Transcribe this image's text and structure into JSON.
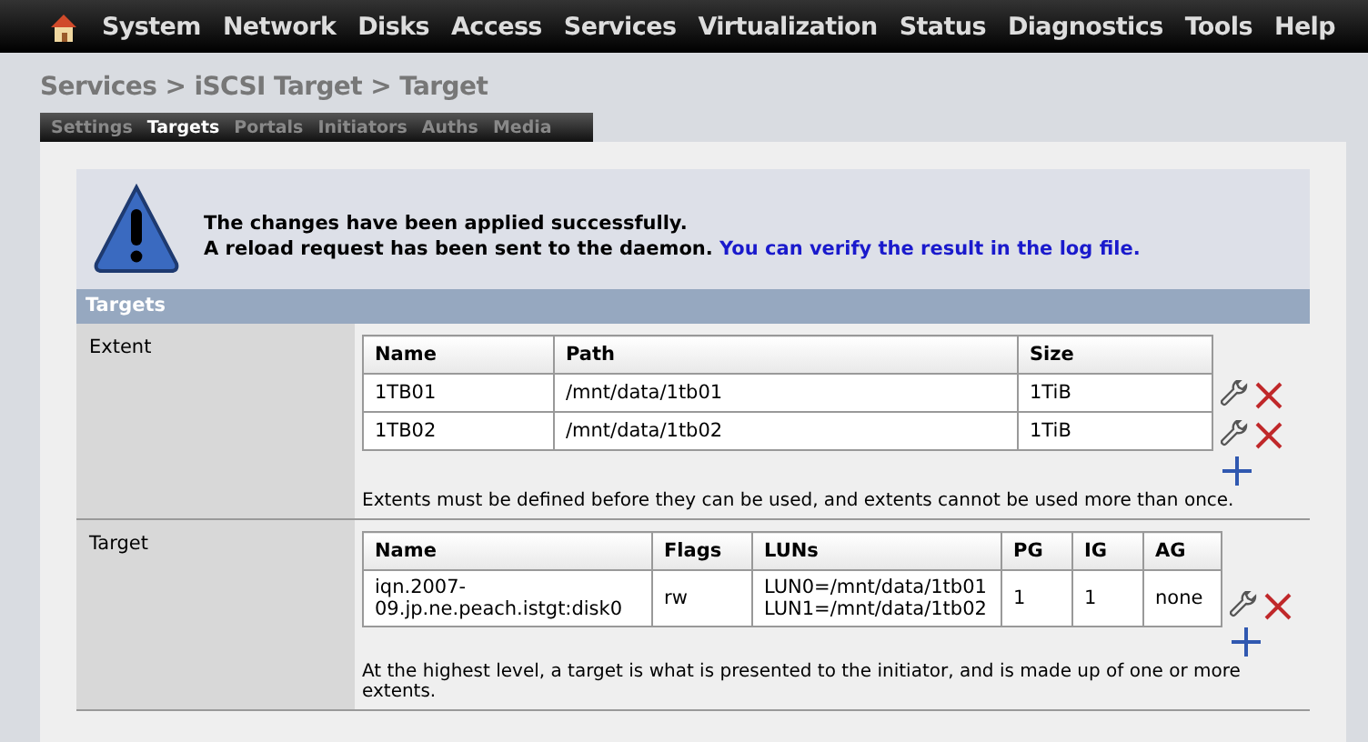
{
  "menu": [
    "System",
    "Network",
    "Disks",
    "Access",
    "Services",
    "Virtualization",
    "Status",
    "Diagnostics",
    "Tools",
    "Help"
  ],
  "breadcrumb": "Services > iSCSI Target > Target",
  "tabs": [
    {
      "label": "Settings",
      "selected": false
    },
    {
      "label": "Targets",
      "selected": true
    },
    {
      "label": "Portals",
      "selected": false
    },
    {
      "label": "Initiators",
      "selected": false
    },
    {
      "label": "Auths",
      "selected": false
    },
    {
      "label": "Media",
      "selected": false
    }
  ],
  "message": {
    "line1": "The changes have been applied successfully.",
    "line2": "A reload request has been sent to the daemon.",
    "link": "You can verify the result in the log file."
  },
  "section_title": "Targets",
  "extent": {
    "label": "Extent",
    "columns": [
      "Name",
      "Path",
      "Size"
    ],
    "rows": [
      [
        "1TB01",
        "/mnt/data/1tb01",
        "1TiB"
      ],
      [
        "1TB02",
        "/mnt/data/1tb02",
        "1TiB"
      ]
    ],
    "note": "Extents must be defined before they can be used, and extents cannot be used more than once."
  },
  "target": {
    "label": "Target",
    "columns": [
      "Name",
      "Flags",
      "LUNs",
      "PG",
      "IG",
      "AG"
    ],
    "rows": [
      {
        "name": "iqn.2007-09.jp.ne.peach.istgt:disk0",
        "flags": "rw",
        "luns": [
          "LUN0=/mnt/data/1tb01",
          "LUN1=/mnt/data/1tb02"
        ],
        "pg": "1",
        "ig": "1",
        "ag": "none"
      }
    ],
    "note": "At the highest level, a target is what is presented to the initiator, and is made up of one or more extents."
  }
}
